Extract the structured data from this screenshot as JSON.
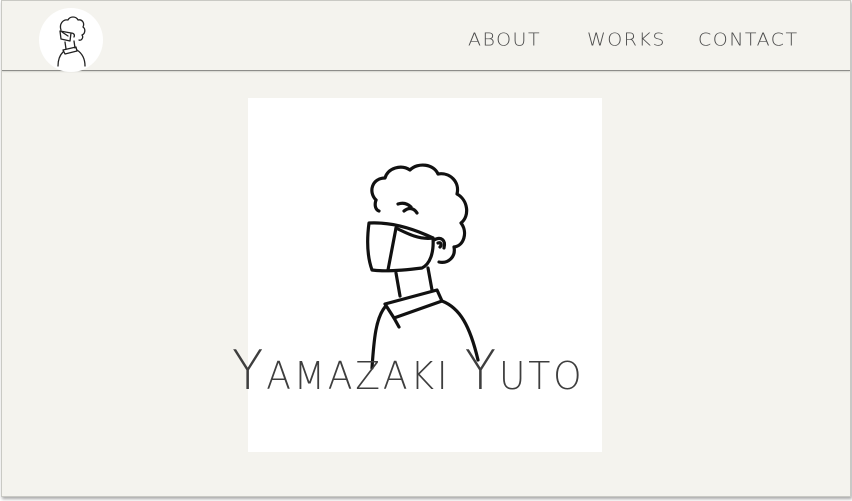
{
  "header": {
    "logo_icon": "avatar-face-mask-icon",
    "nav": {
      "about": "ABOUT",
      "works": "WORKS",
      "contact": "CONTACT"
    }
  },
  "hero": {
    "illustration_icon": "person-wearing-mask-illustration",
    "title_first_initial": "Y",
    "title_first_rest": "AMAZAKI",
    "title_last_initial": "Y",
    "title_last_rest": "UTO"
  },
  "colors": {
    "page_background": "#f4f3ee",
    "card_background": "#ffffff",
    "text": "#3e3e3e",
    "header_border": "#8d8d8a"
  }
}
